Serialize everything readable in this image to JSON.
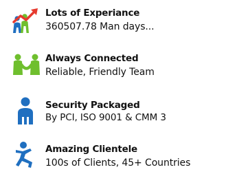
{
  "features": [
    {
      "icon": "people-growth-arrow-icon",
      "title": "Lots of Experiance",
      "description": "360507.78 Man days..."
    },
    {
      "icon": "connected-people-icon",
      "title": "Always Connected",
      "description": "Reliable, Friendly Team"
    },
    {
      "icon": "secure-user-icon",
      "title": "Security Packaged",
      "description": "By PCI, ISO 9001 & CMM 3"
    },
    {
      "icon": "running-person-icon",
      "title": "Amazing Clientele",
      "description": "100s of Clients, 45+ Countries"
    }
  ],
  "colors": {
    "green": "#6fbf2e",
    "blue": "#1f6fc0",
    "red": "#e63a2e",
    "text": "#111111"
  }
}
